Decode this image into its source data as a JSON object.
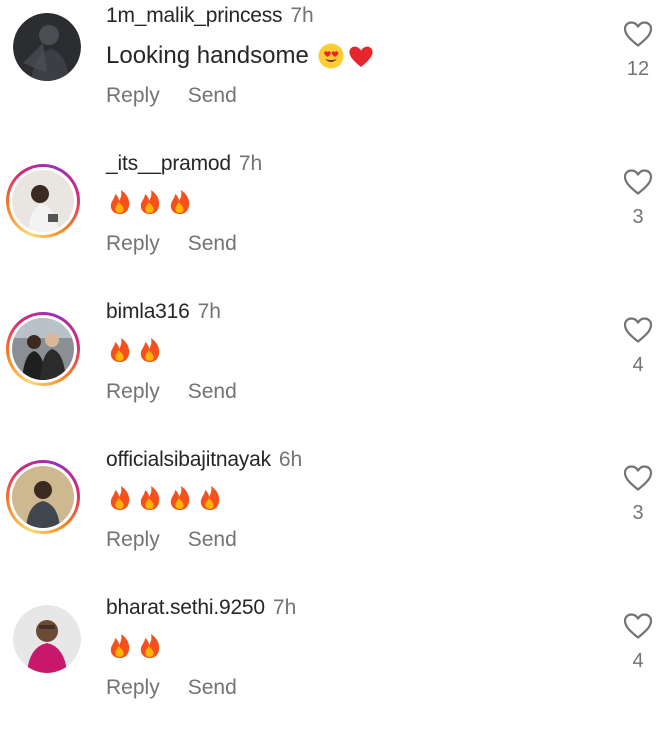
{
  "comments": [
    {
      "username": "1m_malik_princess",
      "time": "7h",
      "text": "Looking handsome",
      "emojis": [
        "heart-eyes-emoji",
        "red-heart-emoji"
      ],
      "reply": "Reply",
      "send": "Send",
      "likes": "12",
      "has_story_ring": false
    },
    {
      "username": "_its__pramod",
      "time": "7h",
      "text": "",
      "emojis": [
        "fire-emoji",
        "fire-emoji",
        "fire-emoji"
      ],
      "reply": "Reply",
      "send": "Send",
      "likes": "3",
      "has_story_ring": true
    },
    {
      "username": "bimla316",
      "time": "7h",
      "text": "",
      "emojis": [
        "fire-emoji",
        "fire-emoji"
      ],
      "reply": "Reply",
      "send": "Send",
      "likes": "4",
      "has_story_ring": true
    },
    {
      "username": "officialsibajitnayak",
      "time": "6h",
      "text": "",
      "emojis": [
        "fire-emoji",
        "fire-emoji",
        "fire-emoji",
        "fire-emoji"
      ],
      "reply": "Reply",
      "send": "Send",
      "likes": "3",
      "has_story_ring": true
    },
    {
      "username": "bharat.sethi.9250",
      "time": "7h",
      "text": "",
      "emojis": [
        "fire-emoji",
        "fire-emoji"
      ],
      "reply": "Reply",
      "send": "Send",
      "likes": "4",
      "has_story_ring": false
    }
  ],
  "colors": {
    "text": "#262626",
    "muted": "#737373",
    "heart": "#e8242d",
    "fire": "#f4511e"
  }
}
